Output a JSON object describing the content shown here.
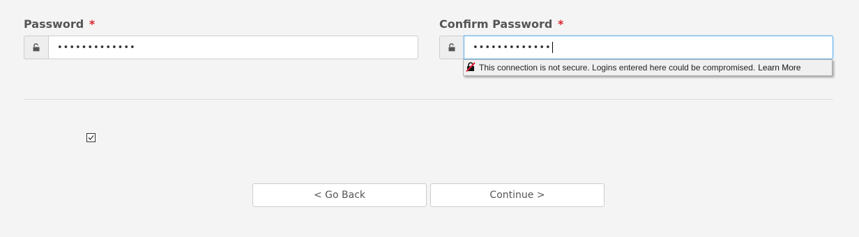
{
  "password": {
    "label": "Password",
    "required_mark": "*",
    "value_masked": "•••••••••••••",
    "icon": "unlock-icon"
  },
  "confirm_password": {
    "label": "Confirm Password",
    "required_mark": "*",
    "value_masked": "•••••••••••••",
    "icon": "unlock-icon",
    "focused": true
  },
  "insecure_warning": {
    "icon": "insecure-lock-icon",
    "message": "This connection is not secure. Logins entered here could be compromised.",
    "link_label": "Learn More"
  },
  "agreement_checkbox": {
    "checked": true
  },
  "buttons": {
    "back_label": "< Go Back",
    "continue_label": "Continue >"
  },
  "colors": {
    "background": "#f4f4f4",
    "required": "#d9242c",
    "label": "#555555",
    "focus_border": "#66afe9"
  }
}
